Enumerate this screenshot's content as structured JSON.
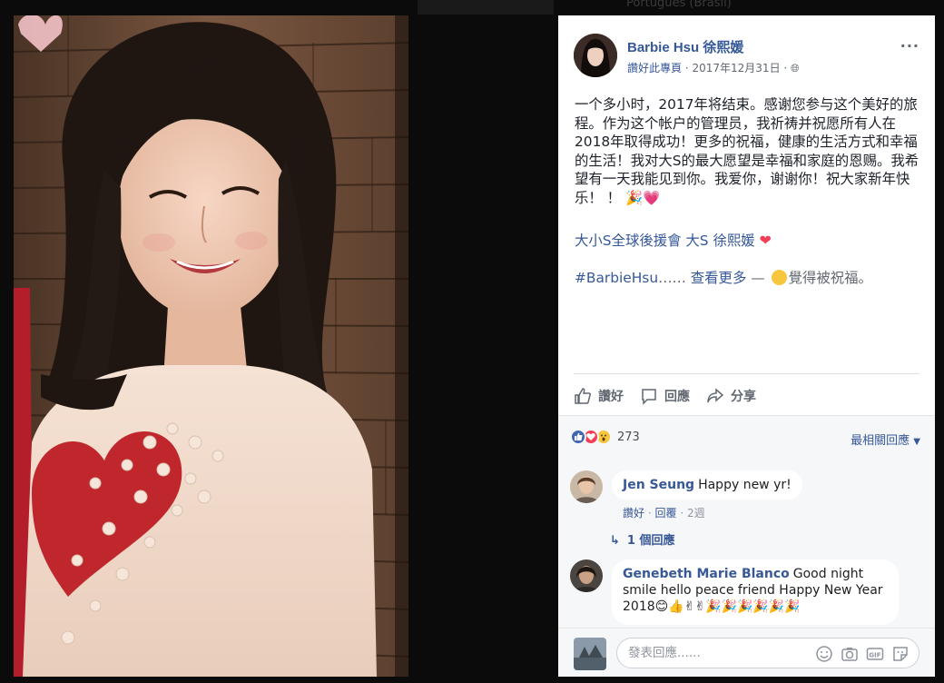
{
  "background": {
    "hint_top": "Português (Brasil)"
  },
  "post": {
    "author": "Barbie Hsu 徐熙媛",
    "like_page": "讚好此專頁",
    "date": "2017年12月31日",
    "text": "一个多小时，2017年将结束。感谢您参与这个美好的旅程。作为这个帐户的管理员，我祈祷并祝愿所有人在2018年取得成功！更多的祝福，健康的生活方式和幸福的生活！我对大S的最大愿望是幸福和家庭的恩赐。我希望有一天我能见到你。我爱你，谢谢你！祝大家新年快乐！ ！",
    "tags": "大小S全球後援會 大S 徐熙媛",
    "hashtag": "#BarbieHsu",
    "ellipsis": "……",
    "see_more": "查看更多",
    "dash": " — ",
    "feeling": "覺得被祝福。"
  },
  "actions": {
    "like": "讚好",
    "comment": "回應",
    "share": "分享"
  },
  "reactions": {
    "count": "273",
    "relevance": "最相關回應"
  },
  "comments": [
    {
      "name": "Jen Seung",
      "text": "Happy new yr!",
      "like": "讚好",
      "reply": "回覆",
      "time": "2週",
      "replies": "1 個回應"
    },
    {
      "name": "Genebeth Marie Blanco",
      "text": "Good night smile hello peace friend Happy New Year 2018"
    }
  ],
  "composer": {
    "placeholder": "發表回應......"
  },
  "colors": {
    "link": "#365899",
    "heart": "#f33e58",
    "panel_bg": "#ffffff",
    "comments_bg": "#f6f7f9"
  }
}
